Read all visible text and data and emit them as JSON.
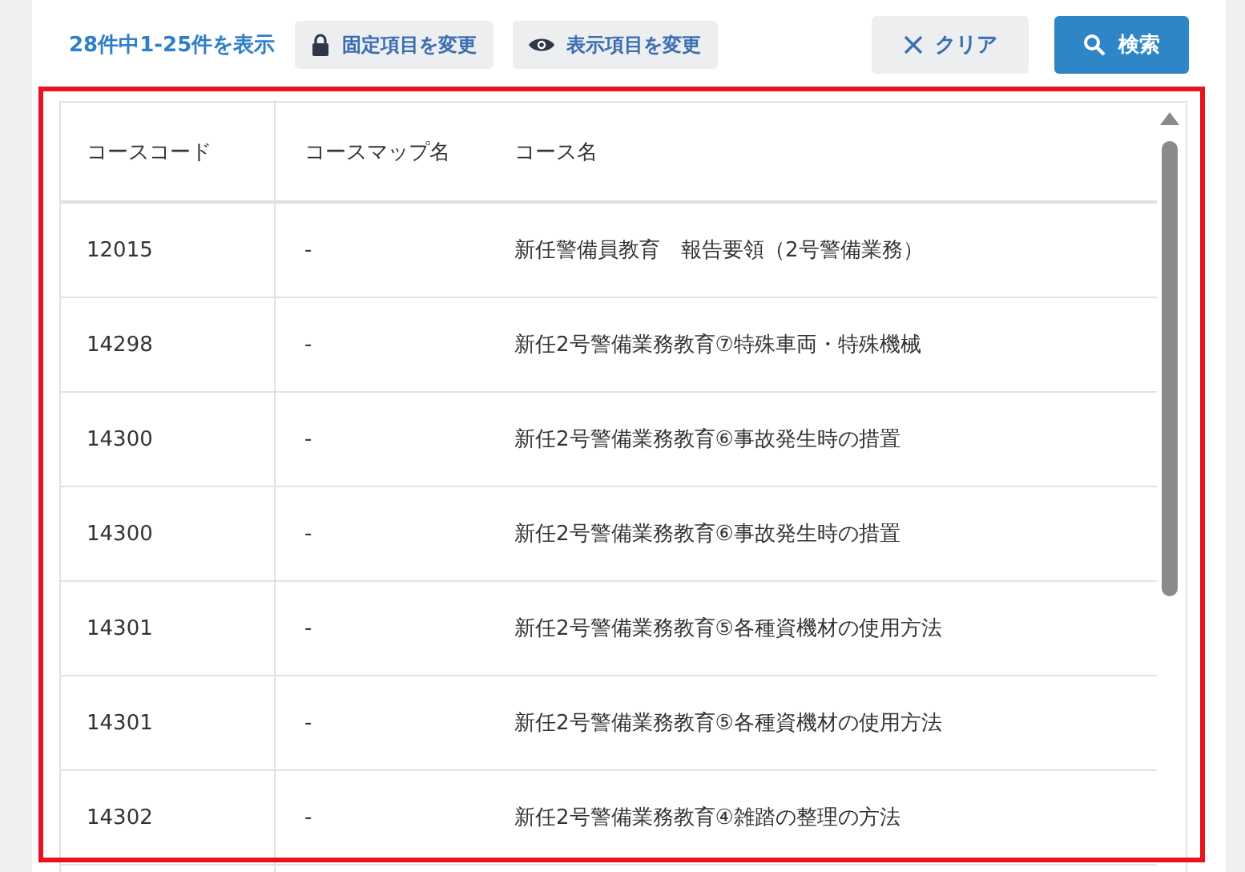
{
  "toolbar": {
    "result_count": "28件中1-25件を表示",
    "buttons": [
      {
        "kind": "lock",
        "label": "固定項目を変更"
      },
      {
        "kind": "eye",
        "label": "表示項目を変更"
      },
      {
        "kind": "clear",
        "label": "クリア"
      },
      {
        "kind": "search",
        "label": "検索"
      }
    ]
  },
  "table": {
    "columns": [
      "コースコード",
      "コースマップ名",
      "コース名"
    ],
    "rows": [
      [
        "12015",
        "-",
        "新任警備員教育　報告要領（2号警備業務）"
      ],
      [
        "14298",
        "-",
        "新任2号警備業務教育⑦特殊車両・特殊機械"
      ],
      [
        "14300",
        "-",
        "新任2号警備業務教育⑥事故発生時の措置"
      ],
      [
        "14300",
        "-",
        "新任2号警備業務教育⑥事故発生時の措置"
      ],
      [
        "14301",
        "-",
        "新任2号警備業務教育⑤各種資機材の使用方法"
      ],
      [
        "14301",
        "-",
        "新任2号警備業務教育⑤各種資機材の使用方法"
      ],
      [
        "14302",
        "-",
        "新任2号警備業務教育④雑踏の整理の方法"
      ]
    ]
  }
}
